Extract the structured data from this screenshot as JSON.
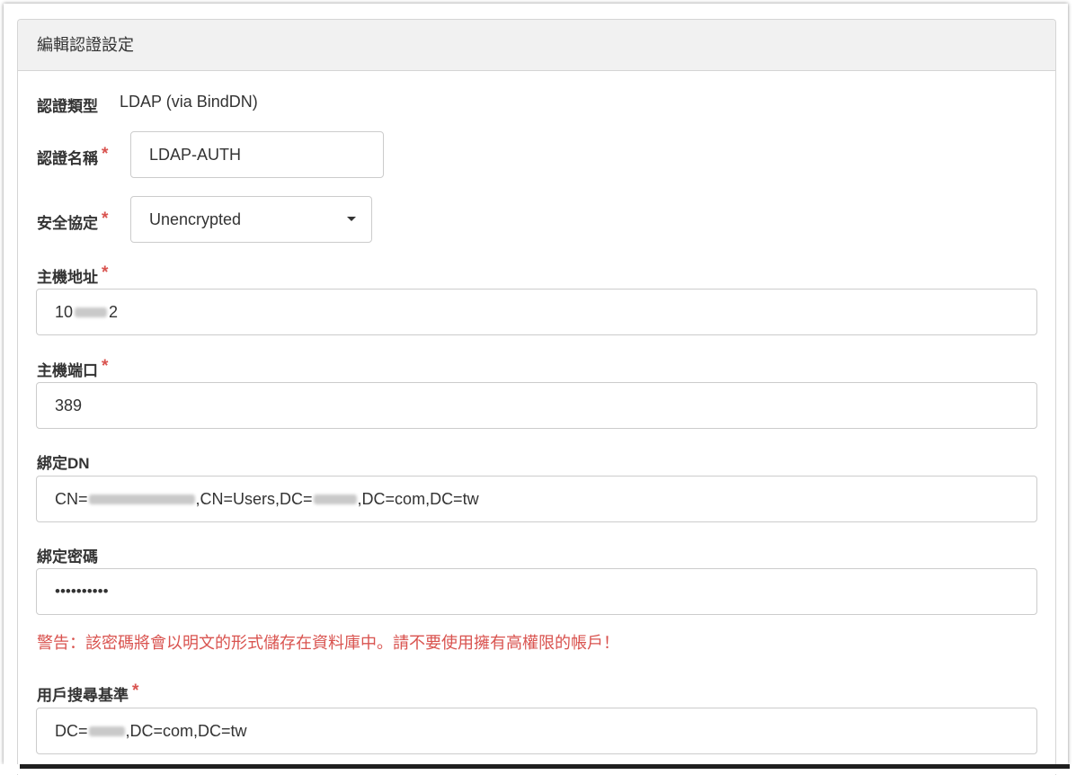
{
  "panel": {
    "title": "編輯認證設定"
  },
  "form": {
    "auth_type": {
      "label": "認證類型",
      "value": "LDAP (via BindDN)"
    },
    "auth_name": {
      "label": "認證名稱",
      "value": "LDAP-AUTH",
      "required_mark": "*"
    },
    "security_protocol": {
      "label": "安全協定",
      "selected": "Unencrypted",
      "required_mark": "*"
    },
    "host_address": {
      "label": "主機地址",
      "value_prefix": "10",
      "value_suffix": "2",
      "required_mark": "*"
    },
    "host_port": {
      "label": "主機端口",
      "value": "389",
      "required_mark": "*"
    },
    "bind_dn": {
      "label": "綁定DN",
      "part1": "CN=",
      "part2": ",CN=Users,DC=",
      "part3": ",DC=com,DC=tw"
    },
    "bind_password": {
      "label": "綁定密碼",
      "value": "••••••••••"
    },
    "warning": "警告：該密碼將會以明文的形式儲存在資料庫中。請不要使用擁有高權限的帳戶！",
    "user_search_base": {
      "label": "用戶搜尋基準",
      "part1": "DC=",
      "part2": ",DC=com,DC=tw",
      "required_mark": "*"
    }
  },
  "colors": {
    "required": "#d9534f",
    "warning": "#d9534f",
    "heading_bg": "#f1f1f1"
  }
}
